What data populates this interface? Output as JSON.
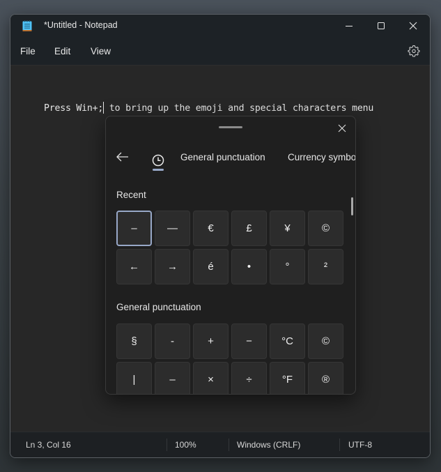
{
  "window": {
    "title": "*Untitled - Notepad",
    "controls": {
      "minimize": "minimize-icon",
      "maximize": "maximize-icon",
      "close": "close-icon"
    }
  },
  "menu": {
    "items": [
      {
        "label": "File"
      },
      {
        "label": "Edit"
      },
      {
        "label": "View"
      }
    ],
    "settings_icon": "gear-icon"
  },
  "editor": {
    "text_before_caret": "Press Win+;",
    "text_after_caret": " to bring up the emoji and special characters menu"
  },
  "emoji_panel": {
    "tabs": [
      {
        "label": "recent-icon",
        "active": true
      },
      {
        "label": "General punctuation"
      },
      {
        "label": "Currency symbols"
      }
    ],
    "sections": [
      {
        "title": "Recent",
        "symbols": [
          "–",
          "—",
          "€",
          "£",
          "¥",
          "©",
          "←",
          "→",
          "é",
          "•",
          "°",
          "²"
        ],
        "selected_index": 0
      },
      {
        "title": "General punctuation",
        "symbols": [
          "§",
          "-",
          "+",
          "−",
          "°C",
          "©",
          "|",
          "–",
          "×",
          "÷",
          "°F",
          "®"
        ]
      }
    ],
    "accent_color": "#98a8c8"
  },
  "status": {
    "position": "Ln 3, Col 16",
    "zoom": "100%",
    "line_ending": "Windows (CRLF)",
    "encoding": "UTF-8"
  }
}
